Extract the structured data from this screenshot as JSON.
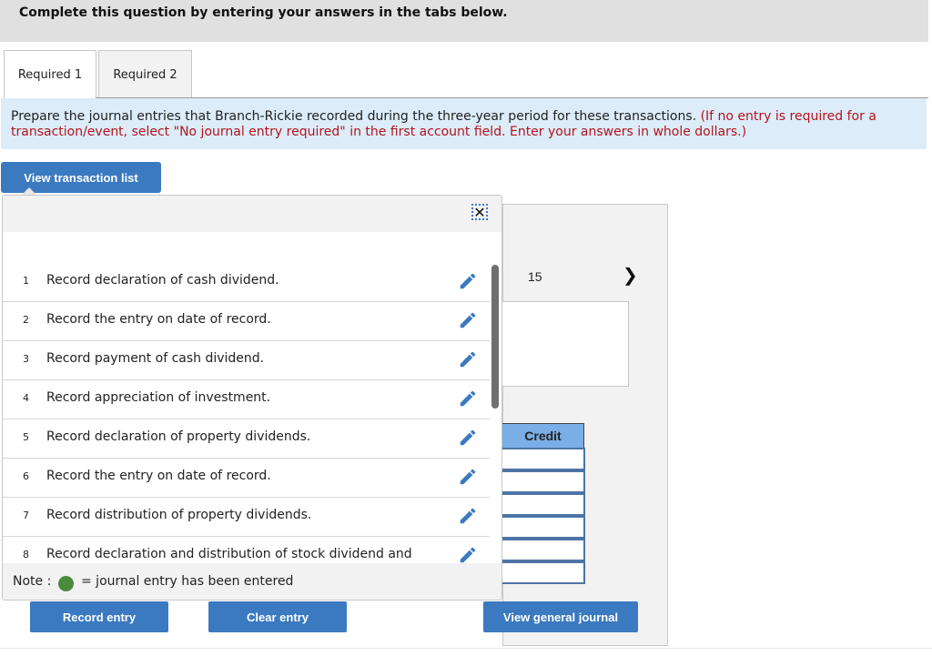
{
  "banner": {
    "text": "Complete this question by entering your answers in the tabs below."
  },
  "tabs": [
    {
      "label": "Required 1",
      "active": true
    },
    {
      "label": "Required 2",
      "active": false
    }
  ],
  "instructions": {
    "main": "Prepare the journal entries that Branch-Rickie recorded during the three-year period for these transactions.",
    "note": "(If no entry is required for a transaction/event, select \"No journal entry required\" in the first account field. Enter your answers in whole dollars.)"
  },
  "view_transaction_list_label": "View transaction list",
  "transaction_popup": {
    "close_icon": "close-icon",
    "items": [
      {
        "num": "1",
        "text": "Record declaration of cash dividend."
      },
      {
        "num": "2",
        "text": "Record the entry on date of record."
      },
      {
        "num": "3",
        "text": "Record payment of cash dividend."
      },
      {
        "num": "4",
        "text": "Record appreciation of investment."
      },
      {
        "num": "5",
        "text": "Record declaration of property dividends."
      },
      {
        "num": "6",
        "text": "Record the entry on date of record."
      },
      {
        "num": "7",
        "text": "Record distribution of property dividends."
      },
      {
        "num": "8",
        "text": "Record declaration and distribution of stock dividend and"
      }
    ],
    "note_label": "Note :",
    "note_text": "= journal entry has been entered",
    "note_dot_color": "#4a8a3c"
  },
  "journal_panel": {
    "page_number": "15",
    "next_icon": "chevron-right-icon",
    "credit_header": "Credit",
    "credit_values": [
      "",
      "",
      "",
      "",
      "",
      ""
    ]
  },
  "buttons": {
    "record_entry": "Record entry",
    "clear_entry": "Clear entry",
    "view_general_journal": "View general journal"
  },
  "colors": {
    "accent": "#3b7ac0",
    "instruction_bg": "#dcecf9",
    "warning_text": "#b3141c",
    "credit_header_bg": "#7aaee6"
  }
}
